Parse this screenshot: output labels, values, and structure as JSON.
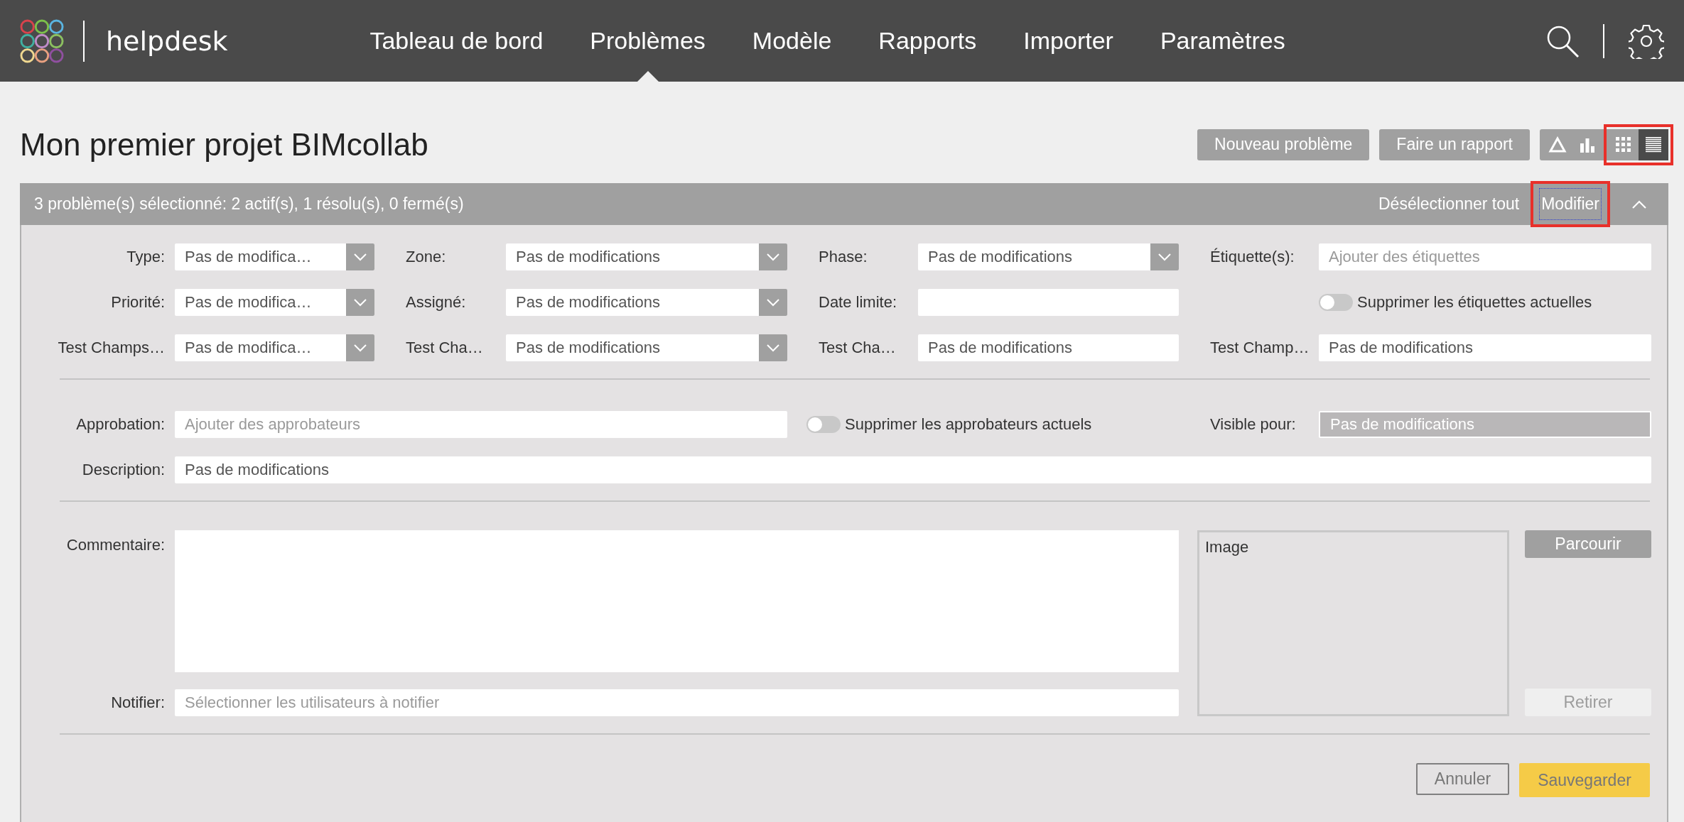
{
  "header": {
    "app_name": "helpdesk",
    "nav": [
      {
        "label": "Tableau de bord",
        "selected": false
      },
      {
        "label": "Problèmes",
        "selected": true
      },
      {
        "label": "Modèle",
        "selected": false
      },
      {
        "label": "Rapports",
        "selected": false
      },
      {
        "label": "Importer",
        "selected": false
      },
      {
        "label": "Paramètres",
        "selected": false
      }
    ]
  },
  "title": "Mon premier projet BIMcollab",
  "toolbar": {
    "buttons": [
      "Nouveau problème",
      "Faire un rapport"
    ],
    "chart_buttons": [
      {
        "kind": "triangle"
      },
      {
        "kind": "bars"
      }
    ],
    "view_switch": {
      "highlighted": true,
      "items": [
        {
          "kind": "grid",
          "selected": false
        },
        {
          "kind": "list",
          "selected": true
        }
      ]
    }
  },
  "selection_bar": {
    "summary": "3 problème(s) sélectionné: 2 actif(s), 1 résolu(s), 0 fermé(s)",
    "deselect": "Désélectionner tout",
    "modify": {
      "label": "Modifier",
      "highlighted": true
    }
  },
  "form": {
    "rows": [
      [
        {
          "kind": "select",
          "label": "Type:",
          "value": "Pas de modifica…"
        },
        {
          "kind": "select",
          "label": "Zone:",
          "value": "Pas de modifications"
        },
        {
          "kind": "select",
          "label": "Phase:",
          "value": "Pas de modifications"
        },
        {
          "kind": "text",
          "label": "Étiquette(s):",
          "placeholder": "Ajouter des étiquettes"
        }
      ],
      [
        {
          "kind": "select",
          "label": "Priorité:",
          "value": "Pas de modifica…"
        },
        {
          "kind": "select",
          "label": "Assigné:",
          "value": "Pas de modifications"
        },
        {
          "kind": "text",
          "label": "Date limite:"
        },
        {
          "kind": "toggle",
          "label": "Supprimer les étiquettes actuelles",
          "on": false
        }
      ],
      [
        {
          "kind": "select",
          "label": "Test Champs…",
          "value": "Pas de modifica…"
        },
        {
          "kind": "select",
          "label": "Test Cha…",
          "value": "Pas de modifications"
        },
        {
          "kind": "text",
          "label": "Test Cha…",
          "value": "Pas de modifications"
        },
        {
          "kind": "text",
          "label": "Test Champ…",
          "value": "Pas de modifications"
        }
      ]
    ],
    "approval": {
      "label": "Approbation:",
      "placeholder": "Ajouter des approbateurs"
    },
    "remove_approvers": {
      "label": "Supprimer les approbateurs actuels",
      "on": false
    },
    "visible_to": {
      "label": "Visible pour:",
      "placeholder": "Pas de modifications"
    },
    "description": {
      "label": "Description:",
      "value": "Pas de modifications"
    },
    "comment": {
      "label": "Commentaire:"
    },
    "notify": {
      "label": "Notifier:",
      "placeholder": "Sélectionner les utilisateurs à notifier"
    },
    "image": {
      "label": "Image"
    },
    "browse": "Parcourir",
    "remove": {
      "label": "Retirer",
      "disabled": true
    },
    "cancel": "Annuler",
    "save": "Sauvegarder"
  }
}
